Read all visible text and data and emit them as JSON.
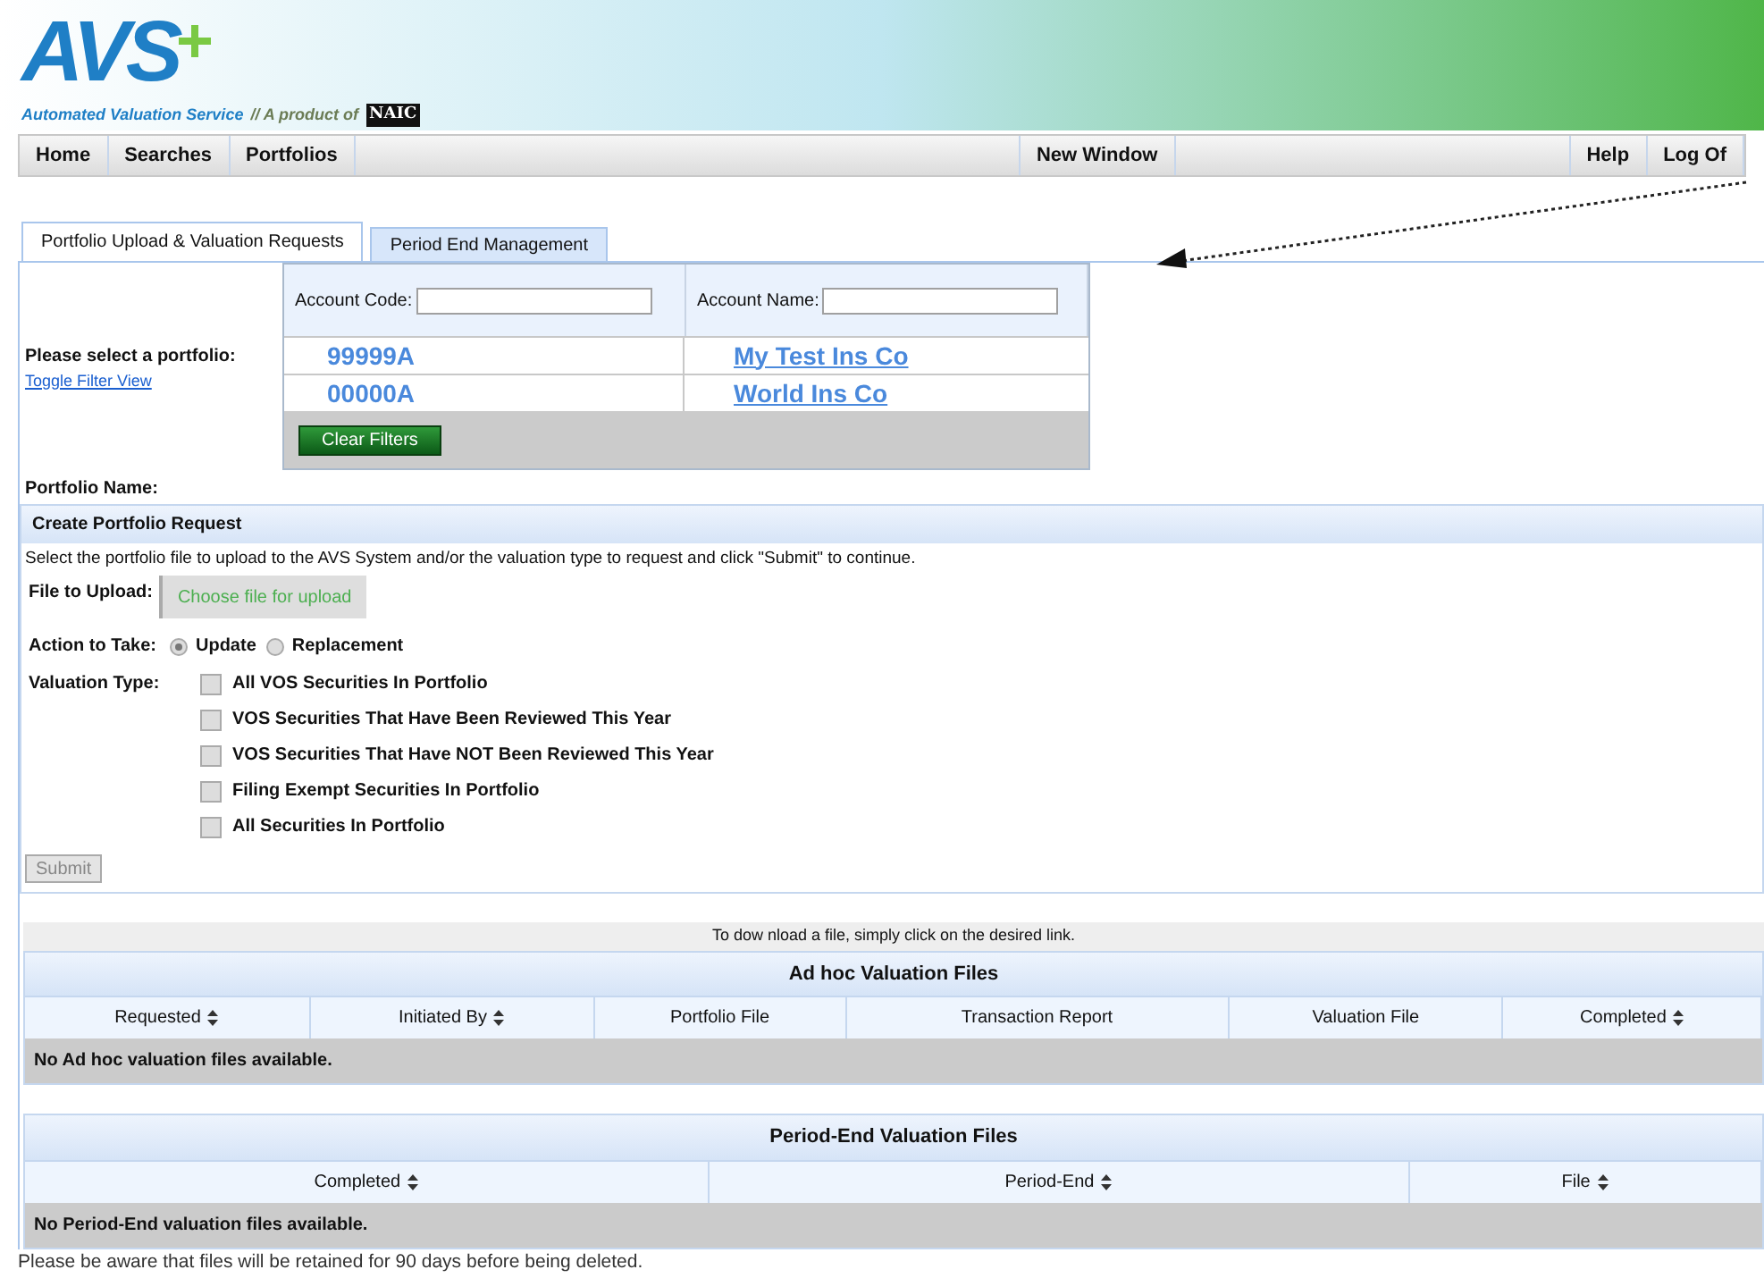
{
  "header": {
    "logo_text": "AVS",
    "tagline": "Automated Valuation Service",
    "product_of": "// A product of",
    "naic": "NAIC"
  },
  "nav": {
    "left": [
      "Home",
      "Searches",
      "Portfolios"
    ],
    "center": [
      "New Window"
    ],
    "right": [
      "Help",
      "Log Of"
    ]
  },
  "tabs": [
    {
      "label": "Portfolio Upload & Valuation Requests",
      "selected": true
    },
    {
      "label": "Period End Management",
      "selected": false
    }
  ],
  "portfolio_select": {
    "label": "Please select a portfolio:",
    "toggle_link": "Toggle Filter View",
    "filters": [
      {
        "label": "Account Code:"
      },
      {
        "label": "Account Name:"
      }
    ],
    "rows": [
      {
        "code": "99999A",
        "name": "My Test Ins Co"
      },
      {
        "code": "00000A",
        "name": "World Ins Co"
      }
    ],
    "clear_button": "Clear Filters"
  },
  "portfolio_name_label": "Portfolio Name:",
  "request": {
    "title": "Create Portfolio Request",
    "instructions": "Select the portfolio file to upload to the AVS System and/or the valuation type to request and click \"Submit\" to continue.",
    "file_label": "File to Upload:",
    "file_button": "Choose file for upload",
    "action_label": "Action to Take:",
    "actions": [
      {
        "label": "Update",
        "selected": true
      },
      {
        "label": "Replacement",
        "selected": false
      }
    ],
    "valuation_label": "Valuation Type:",
    "valuation_types": [
      {
        "label": "All VOS Securities In Portfolio",
        "checked": false
      },
      {
        "label": "VOS Securities That Have Been Reviewed This Year",
        "checked": false
      },
      {
        "label": "VOS Securities That Have NOT Been Reviewed This Year",
        "checked": false
      },
      {
        "label": "Filing Exempt Securities In Portfolio",
        "checked": false
      },
      {
        "label": "All Securities In Portfolio",
        "checked": false
      }
    ],
    "submit": "Submit"
  },
  "download_hint": "To dow nload a file, simply click on the desired link.",
  "adhoc_table": {
    "title": "Ad hoc Valuation Files",
    "columns": [
      {
        "label": "Requested",
        "sortable": true
      },
      {
        "label": "Initiated By",
        "sortable": true
      },
      {
        "label": "Portfolio File",
        "sortable": false
      },
      {
        "label": "Transaction Report",
        "sortable": false
      },
      {
        "label": "Valuation File",
        "sortable": false
      },
      {
        "label": "Completed",
        "sortable": true
      }
    ],
    "empty": "No Ad hoc valuation files available."
  },
  "period_table": {
    "title": "Period-End Valuation Files",
    "columns": [
      {
        "label": "Completed",
        "sortable": true
      },
      {
        "label": "Period-End",
        "sortable": true
      },
      {
        "label": "File",
        "sortable": true
      }
    ],
    "empty": "No Period-End valuation files available."
  },
  "footer_note": "Please be aware that files will be retained for 90 days before being deleted."
}
